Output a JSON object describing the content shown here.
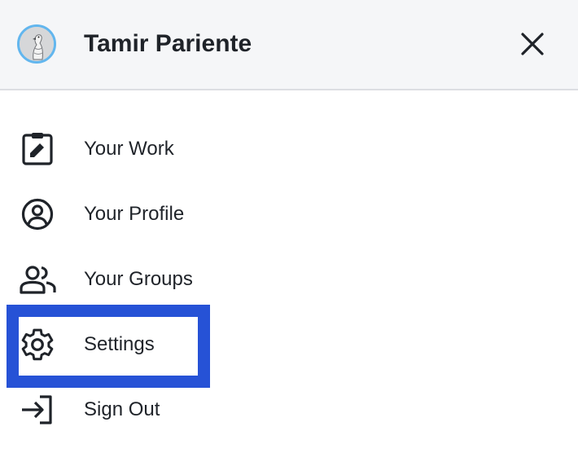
{
  "header": {
    "user_name": "Tamir Pariente",
    "avatar_icon": "goose-avatar-icon",
    "close_icon": "close-icon"
  },
  "menu": {
    "items": [
      {
        "label": "Your Work",
        "icon": "clipboard-edit-icon"
      },
      {
        "label": "Your Profile",
        "icon": "user-circle-icon"
      },
      {
        "label": "Your Groups",
        "icon": "people-icon"
      },
      {
        "label": "Settings",
        "icon": "gear-icon"
      },
      {
        "label": "Sign Out",
        "icon": "sign-out-icon"
      }
    ],
    "highlighted_item": "Settings"
  },
  "colors": {
    "header_background": "#f5f6f8",
    "avatar_ring": "#62b6ee",
    "highlight_border": "#2652d6",
    "text": "#1f2329"
  }
}
